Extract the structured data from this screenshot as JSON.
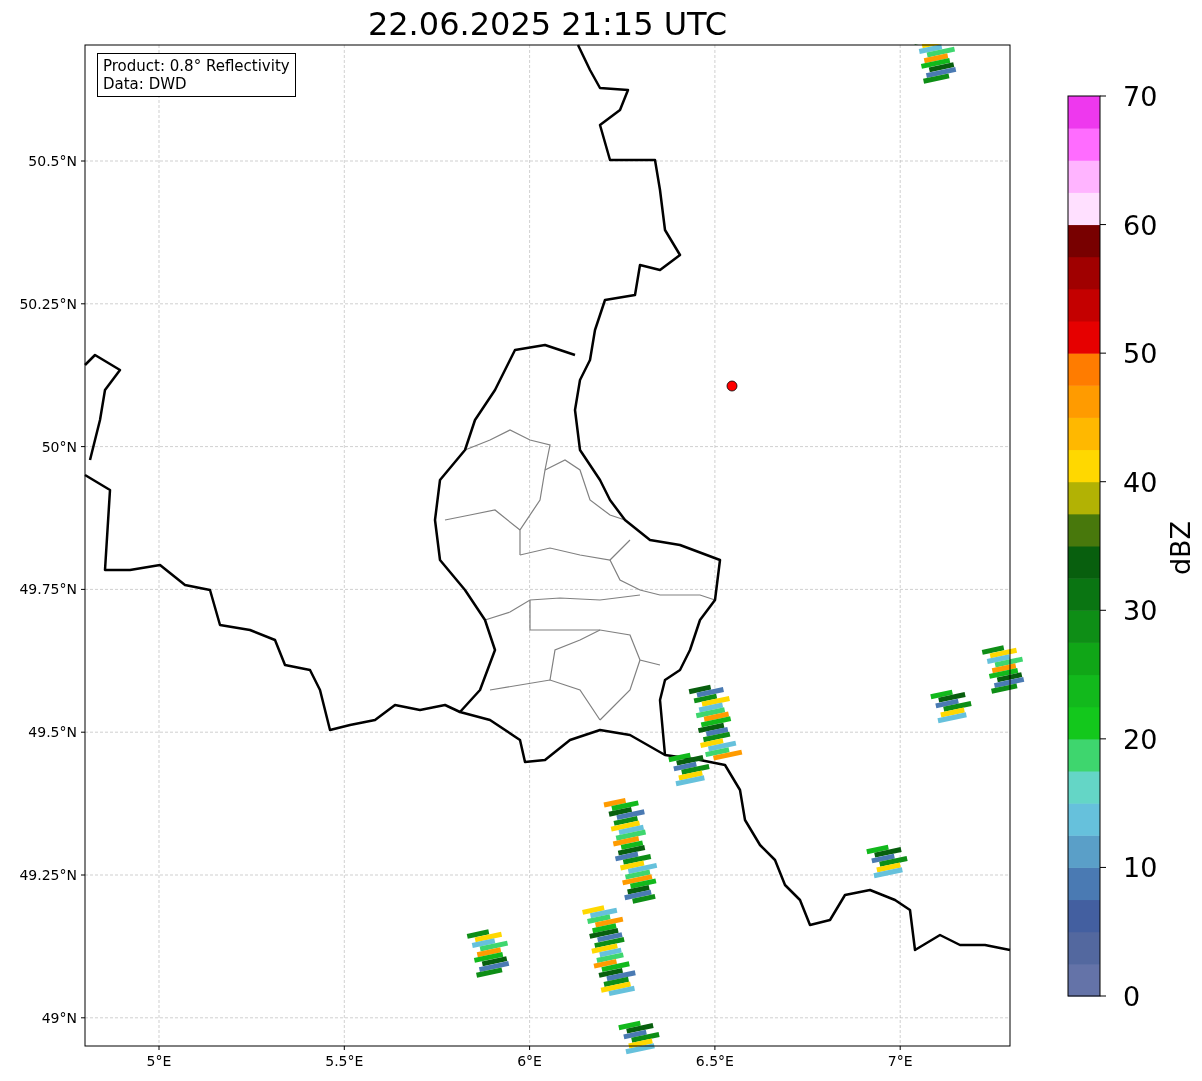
{
  "title": "22.06.2025 21:15 UTC",
  "info_box": [
    "Product: 0.8° Reflectivity",
    "Data: DWD"
  ],
  "map": {
    "x_ticks": [
      "5°E",
      "5.5°E",
      "6°E",
      "6.5°E",
      "7°E"
    ],
    "y_ticks": [
      "50.5°N",
      "50.25°N",
      "50°N",
      "49.75°N",
      "49.5°N",
      "49.25°N",
      "49°N"
    ]
  },
  "colorbar": {
    "label": "dBZ",
    "ticks": [
      "70",
      "60",
      "50",
      "40",
      "30",
      "20",
      "10",
      "0"
    ],
    "bins": [
      {
        "color": "#6473a8"
      },
      {
        "color": "#53689f"
      },
      {
        "color": "#435fa0"
      },
      {
        "color": "#4a7ab3"
      },
      {
        "color": "#5a9fc8"
      },
      {
        "color": "#66c1dc"
      },
      {
        "color": "#64d6c6"
      },
      {
        "color": "#3ed66e"
      },
      {
        "color": "#13c81c"
      },
      {
        "color": "#12b91c"
      },
      {
        "color": "#10a617"
      },
      {
        "color": "#0e8e16"
      },
      {
        "color": "#0a7512"
      },
      {
        "color": "#085f0e"
      },
      {
        "color": "#48780c"
      },
      {
        "color": "#b2b204"
      },
      {
        "color": "#ffd800"
      },
      {
        "color": "#ffb800"
      },
      {
        "color": "#ff9b00"
      },
      {
        "color": "#ff7c00"
      },
      {
        "color": "#e60000"
      },
      {
        "color": "#c40000"
      },
      {
        "color": "#a00000"
      },
      {
        "color": "#780000"
      },
      {
        "color": "#ffe0ff"
      },
      {
        "color": "#ffb4ff"
      },
      {
        "color": "#ff6cff"
      },
      {
        "color": "#ee38ee"
      }
    ]
  }
}
